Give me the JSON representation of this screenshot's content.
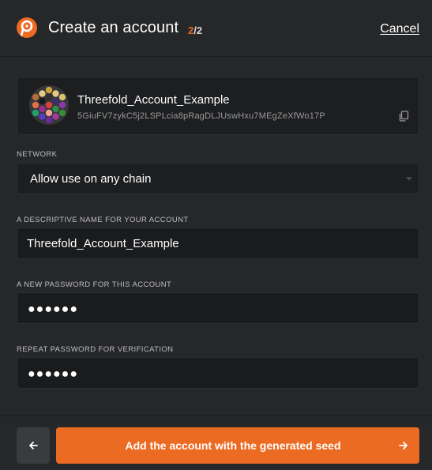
{
  "header": {
    "title": "Create an account",
    "step_current": "2",
    "step_total": "/2",
    "cancel_label": "Cancel",
    "logo_icon": "polkadot-logo-icon"
  },
  "account": {
    "name": "Threefold_Account_Example",
    "address": "5GiuFV7zykC5j2LSPLcia8pRagDLJUswHxu7MEgZeXfWo17P",
    "copy_icon": "copy-icon"
  },
  "network": {
    "label": "NETWORK",
    "value": "Allow use on any chain"
  },
  "name_field": {
    "label": "A DESCRIPTIVE NAME FOR YOUR ACCOUNT",
    "value": "Threefold_Account_Example"
  },
  "password_field": {
    "label": "A NEW PASSWORD FOR THIS ACCOUNT",
    "masked_value": "●●●●●●"
  },
  "repeat_password_field": {
    "label": "REPEAT PASSWORD FOR VERIFICATION",
    "masked_value": "●●●●●●"
  },
  "footer": {
    "back_icon": "arrow-left-icon",
    "primary_label": "Add the account with the generated seed",
    "primary_icon": "arrow-right-icon"
  },
  "colors": {
    "accent": "#ec6b23",
    "background": "#262729",
    "input_background": "#1a1b1d"
  }
}
